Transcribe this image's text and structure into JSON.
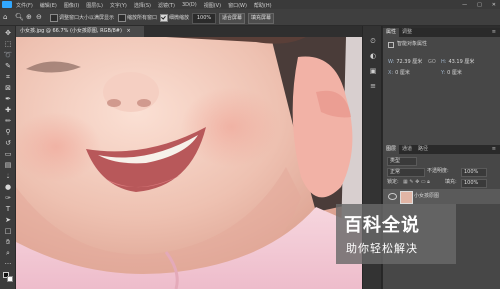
{
  "app": {
    "logo": "Ps"
  },
  "menubar": {
    "items": [
      "文件(F)",
      "编辑(E)",
      "图像(I)",
      "图层(L)",
      "文字(Y)",
      "选择(S)",
      "滤镜(T)",
      "3D(D)",
      "视图(V)",
      "窗口(W)",
      "帮助(H)"
    ],
    "window_buttons": [
      "—",
      "□",
      "✕"
    ]
  },
  "options": {
    "resize_windows_label": "调整窗口大小以满屏显示",
    "resize_windows_checked": false,
    "zoom_all_label": "缩放所有窗口",
    "zoom_all_checked": false,
    "scrubby_zoom_label": "细微缩放",
    "scrubby_zoom_checked": true,
    "zoom_value": "100%",
    "fit_screen_label": "适合屏幕",
    "fill_screen_label": "填充屏幕"
  },
  "document": {
    "tab_title": "小女孩.jpg @ 66.7% (小女孩原图, RGB/8#)",
    "tab_close": "×"
  },
  "properties_panel": {
    "tabs": [
      "属性",
      "调整"
    ],
    "title": "智能对象属性",
    "w_label": "W:",
    "w_value": "72.39 厘米",
    "h_label": "H:",
    "h_value": "43.19 厘米",
    "x_label": "X:",
    "x_value": "0 厘米",
    "y_label": "Y:",
    "y_value": "0 厘米",
    "link_label": "GO"
  },
  "layers_panel": {
    "tabs": [
      "图层",
      "通道",
      "路径"
    ],
    "filter_label": "类型",
    "blend_mode": "正常",
    "opacity_label": "不透明度:",
    "opacity_value": "100%",
    "lock_label": "锁定:",
    "fill_label": "填充:",
    "fill_value": "100%",
    "layer_name": "小女孩原图"
  },
  "watermark": {
    "title": "百科全说",
    "subtitle": "助你轻松解决"
  },
  "colors": {
    "accent": "#31a8ff",
    "ui_dark": "#282828",
    "panel": "#474747"
  }
}
